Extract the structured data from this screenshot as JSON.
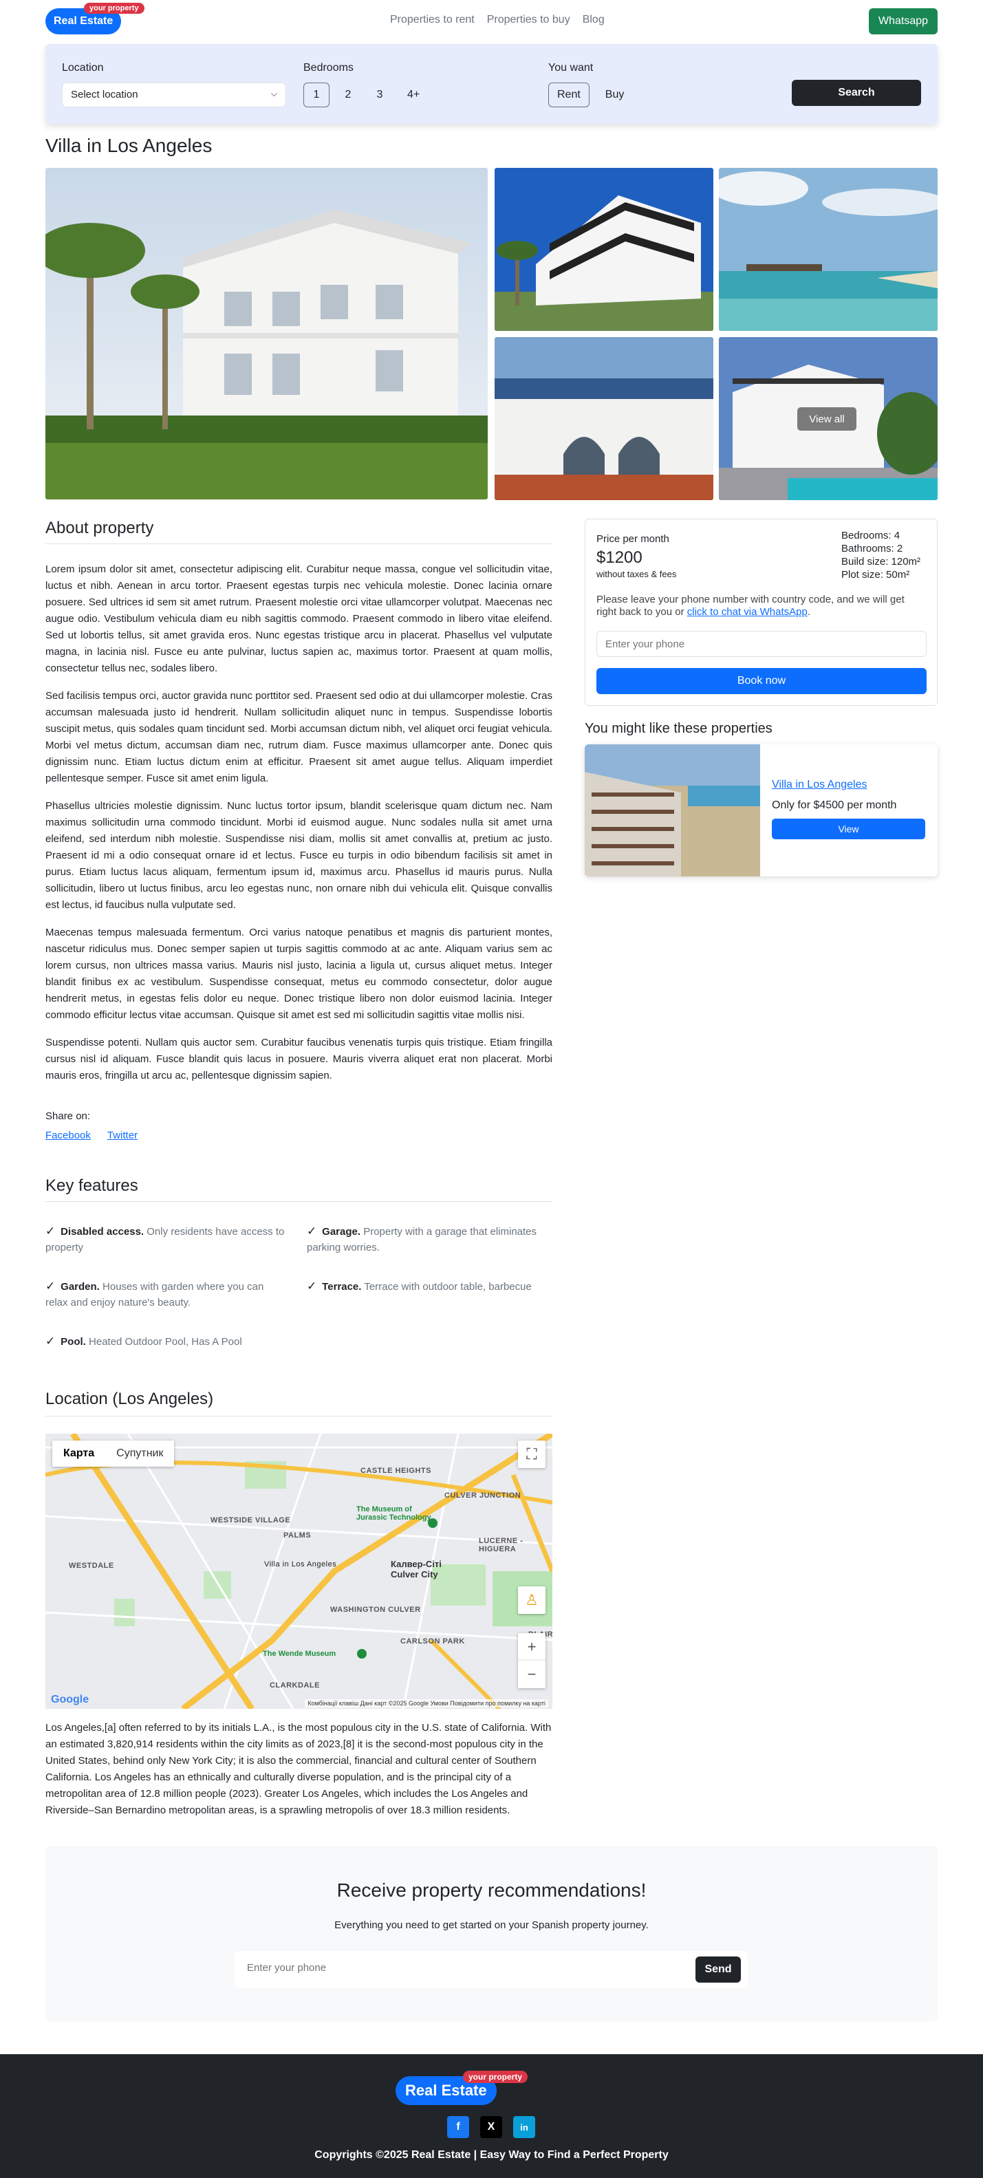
{
  "header": {
    "logo": "Real Estate",
    "logo_tag": "your property",
    "nav": [
      "Properties to rent",
      "Properties to buy",
      "Blog"
    ],
    "whatsapp": "Whatsapp"
  },
  "search": {
    "location_label": "Location",
    "location_value": "Select location",
    "bedrooms_label": "Bedrooms",
    "bedrooms": [
      "1",
      "2",
      "3",
      "4+"
    ],
    "bedrooms_selected": "1",
    "want_label": "You want",
    "want": [
      "Rent",
      "Buy"
    ],
    "want_selected": "Rent",
    "button": "Search"
  },
  "property": {
    "title": "Villa in Los Angeles",
    "view_all": "View all"
  },
  "about": {
    "heading": "About property",
    "paragraphs": [
      "Lorem ipsum dolor sit amet, consectetur adipiscing elit. Curabitur neque massa, congue vel sollicitudin vitae, luctus et nibh. Aenean in arcu tortor. Praesent egestas turpis nec vehicula molestie. Donec lacinia ornare posuere. Sed ultrices id sem sit amet rutrum. Praesent molestie orci vitae ullamcorper volutpat. Maecenas nec augue odio. Vestibulum vehicula diam eu nibh sagittis commodo. Praesent commodo in libero vitae eleifend. Sed ut lobortis tellus, sit amet gravida eros. Nunc egestas tristique arcu in placerat. Phasellus vel vulputate magna, in lacinia nisl. Fusce eu ante pulvinar, luctus sapien ac, maximus tortor. Praesent at quam mollis, consectetur tellus nec, sodales libero.",
      "Sed facilisis tempus orci, auctor gravida nunc porttitor sed. Praesent sed odio at dui ullamcorper molestie. Cras accumsan malesuada justo id hendrerit. Nullam sollicitudin aliquet nunc in tempus. Suspendisse lobortis suscipit metus, quis sodales quam tincidunt sed. Morbi accumsan dictum nibh, vel aliquet orci feugiat vehicula. Morbi vel metus dictum, accumsan diam nec, rutrum diam. Fusce maximus ullamcorper ante. Donec quis dignissim nunc. Etiam luctus dictum enim at efficitur. Praesent sit amet augue tellus. Aliquam imperdiet pellentesque semper. Fusce sit amet enim ligula.",
      "Phasellus ultricies molestie dignissim. Nunc luctus tortor ipsum, blandit scelerisque quam dictum nec. Nam maximus sollicitudin urna commodo tincidunt. Morbi id euismod augue. Nunc sodales nulla sit amet urna eleifend, sed interdum nibh molestie. Suspendisse nisi diam, mollis sit amet convallis at, pretium ac justo. Praesent id mi a odio consequat ornare id et lectus. Fusce eu turpis in odio bibendum facilisis sit amet in purus. Etiam luctus lacus aliquam, fermentum ipsum id, maximus arcu. Phasellus id mauris purus. Nulla sollicitudin, libero ut luctus finibus, arcu leo egestas nunc, non ornare nibh dui vehicula elit. Quisque convallis est lectus, id faucibus nulla vulputate sed.",
      "Maecenas tempus malesuada fermentum. Orci varius natoque penatibus et magnis dis parturient montes, nascetur ridiculus mus. Donec semper sapien ut turpis sagittis commodo at ac ante. Aliquam varius sem ac lorem cursus, non ultrices massa varius. Mauris nisl justo, lacinia a ligula ut, cursus aliquet metus. Integer blandit finibus ex ac vestibulum. Suspendisse consequat, metus eu commodo consectetur, dolor augue hendrerit metus, in egestas felis dolor eu neque. Donec tristique libero non dolor euismod lacinia. Integer commodo efficitur lectus vitae accumsan. Quisque sit amet est sed mi sollicitudin sagittis vitae mollis nisi.",
      "Suspendisse potenti. Nullam quis auctor sem. Curabitur faucibus venenatis turpis quis tristique. Etiam fringilla cursus nisl id aliquam. Fusce blandit quis lacus in posuere. Mauris viverra aliquet erat non placerat. Morbi mauris eros, fringilla ut arcu ac, pellentesque dignissim sapien."
    ],
    "share_label": "Share on:",
    "share_links": [
      "Facebook",
      "Twitter"
    ]
  },
  "price_card": {
    "label": "Price per month",
    "amount": "$1200",
    "note": "without taxes & fees",
    "specs": [
      "Bedrooms: 4",
      "Bathrooms: 2",
      "Build size: 120m²",
      "Plot size: 50m²"
    ],
    "message_prefix": "Please leave your phone number with country code, and we will get right back to you or ",
    "message_link": "click to chat via WhatsApp",
    "message_suffix": ".",
    "phone_placeholder": "Enter your phone",
    "book": "Book now"
  },
  "suggestions": {
    "heading": "You might like these properties",
    "items": [
      {
        "title": "Villa in Los Angeles",
        "price": "Only for $4500 per month",
        "button": "View"
      }
    ]
  },
  "features": {
    "heading": "Key features",
    "items": [
      {
        "name": "Disabled access.",
        "desc": "Only residents have access to property"
      },
      {
        "name": "Garage.",
        "desc": "Property with a garage that eliminates parking worries."
      },
      {
        "name": "Garden.",
        "desc": "Houses with garden where you can relax and enjoy nature's beauty."
      },
      {
        "name": "Terrace.",
        "desc": "Terrace with outdoor table, barbecue"
      },
      {
        "name": "Pool.",
        "desc": "Heated Outdoor Pool, Has A Pool"
      }
    ]
  },
  "location": {
    "heading": "Location (Los Angeles)",
    "map_tabs": [
      "Карта",
      "Супутник"
    ],
    "map_labels": [
      "CASTLE HEIGHTS",
      "CULVER JUNCTION",
      "The Museum of Jurassic Technology",
      "WESTSIDE VILLAGE",
      "PALMS",
      "WESTDALE",
      "LUCERNE - HIGUERA",
      "Villa in Los Angeles",
      "Калвер-Сіті Culver City",
      "WASHINGTON CULVER",
      "The Wende Museum",
      "CARLSON PARK",
      "CLARKDALE",
      "BLAIR"
    ],
    "attribution": "Комбінації клавіш   Дані карт ©2025 Google   Умови   Повідомити про помилку на карті",
    "google": "Google",
    "description": "Los Angeles,[a] often referred to by its initials L.A., is the most populous city in the U.S. state of California. With an estimated 3,820,914 residents within the city limits as of 2023,[8] it is the second-most populous city in the United States, behind only New York City; it is also the commercial, financial and cultural center of Southern California. Los Angeles has an ethnically and culturally diverse population, and is the principal city of a metropolitan area of 12.8 million people (2023). Greater Los Angeles, which includes the Los Angeles and Riverside–San Bernardino metropolitan areas, is a sprawling metropolis of over 18.3 million residents."
  },
  "newsletter": {
    "title": "Receive property recommendations!",
    "subtitle": "Everything you need to get started on your Spanish property journey.",
    "placeholder": "Enter your phone",
    "button": "Send"
  },
  "footer": {
    "logo": "Real Estate",
    "logo_tag": "your property",
    "social": [
      "f",
      "X",
      "in"
    ],
    "copyright": "Copyrights ©2025 Real Estate | Easy Way to Find a Perfect Property"
  },
  "colors": {
    "primary": "#0d6efd",
    "dark": "#212529",
    "success": "#198754",
    "danger": "#dc3545",
    "panel": "#e6ecfc"
  }
}
